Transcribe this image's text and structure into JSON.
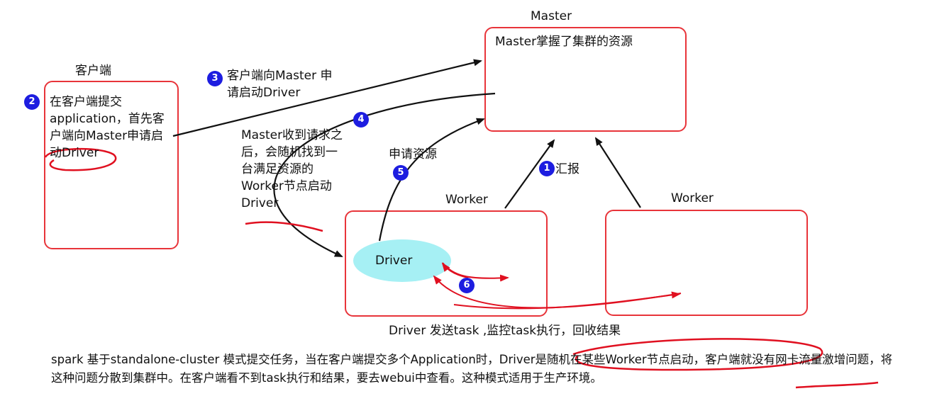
{
  "client": {
    "label": "客户端",
    "text": "在客户端提交application，首先客户端向Master申请启动Driver",
    "badge": "2"
  },
  "master": {
    "title": "Master",
    "text": "Master掌握了集群的资源"
  },
  "step3": {
    "badge": "3",
    "text": "客户端向Master 申请启动Driver"
  },
  "step4": {
    "badge": "4",
    "text": "Master收到请求之后，会随机找到一台满足资源的Worker节点启动Driver"
  },
  "step5": {
    "badge": "5",
    "text": "申请资源"
  },
  "step1": {
    "badge": "1",
    "text": "汇报"
  },
  "step6": {
    "badge": "6"
  },
  "worker1": {
    "title": "Worker"
  },
  "worker2": {
    "title": "Worker"
  },
  "driver": {
    "label": "Driver"
  },
  "caption": "Driver 发送task ,监控task执行，回收结果",
  "footer": "spark 基于standalone-cluster 模式提交任务，当在客户端提交多个Application时，Driver是随机在某些Worker节点启动，客户端就没有网卡流量激增问题，将这种问题分散到集群中。在客户端看不到task执行和结果，要去webui中查看。这种模式适用于生产环境。",
  "colors": {
    "box_border": "#e8343a",
    "badge": "#1d1de0",
    "driver_fill": "#a6f0f4",
    "annotation": "#e01020",
    "arrow": "#111111"
  }
}
